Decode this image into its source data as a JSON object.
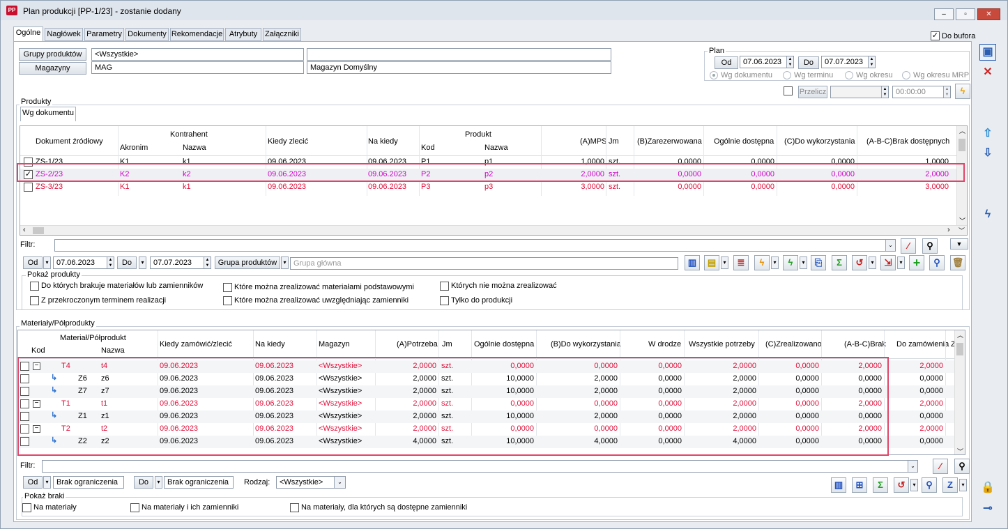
{
  "window": {
    "title": "Plan produkcji [PP-1/23] - zostanie dodany",
    "icon": "PP",
    "minimize": "‒",
    "maximize": "▫",
    "close": "✕"
  },
  "tabs": [
    "Ogólne",
    "Nagłówek",
    "Parametry",
    "Dokumenty",
    "Rekomendacje",
    "Atrybuty",
    "Załączniki"
  ],
  "do_bufora": "Do bufora",
  "header": {
    "grupy_btn": "Grupy produktów",
    "grupy_val": "<Wszystkie>",
    "magazyny_btn": "Magazyny",
    "magazyny_val": "MAG",
    "magazyny_name": "Magazyn Domyślny"
  },
  "plan": {
    "title": "Plan",
    "od": "Od",
    "od_date": "07.06.2023",
    "do": "Do",
    "do_date": "07.07.2023",
    "radios": [
      "Wg dokumentu",
      "Wg terminu",
      "Wg okresu",
      "Wg okresu MRP"
    ],
    "przelicz": "Przelicz",
    "time": "00:00:00"
  },
  "produkty": {
    "title": "Produkty",
    "subtab": "Wg dokumentu",
    "headers": {
      "dokument": "Dokument źródłowy",
      "kontrahent": "Kontrahent",
      "akronim": "Akronim",
      "nazwa": "Nazwa",
      "kiedy": "Kiedy zlecić",
      "na_kiedy": "Na kiedy",
      "produkt": "Produkt",
      "kod": "Kod",
      "pnazwa": "Nazwa",
      "mps": "(A)MPS",
      "jm": "Jm",
      "zarez": "(B)Zarezerwowana",
      "ogolnie": "Ogólnie dostępna",
      "dowyk": "(C)Do wykorzystania",
      "brak": "(A-B-C)Brak dostępnych"
    },
    "rows": [
      {
        "checked": false,
        "dok": "ZS-1/23",
        "akr": "K1",
        "nazwa": "k1",
        "kiedy": "09.06.2023",
        "na": "09.06.2023",
        "kod": "P1",
        "pn": "p1",
        "mps": "1,0000",
        "jm": "szt.",
        "zarez": "0,0000",
        "og": "0,0000",
        "dow": "0,0000",
        "brak": "1,0000",
        "red": false
      },
      {
        "checked": true,
        "dok": "ZS-2/23",
        "akr": "K2",
        "nazwa": "k2",
        "kiedy": "09.06.2023",
        "na": "09.06.2023",
        "kod": "P2",
        "pn": "p2",
        "mps": "2,0000",
        "jm": "szt.",
        "zarez": "0,0000",
        "og": "0,0000",
        "dow": "0,0000",
        "brak": "2,0000",
        "red": true
      },
      {
        "checked": false,
        "dok": "ZS-3/23",
        "akr": "K1",
        "nazwa": "k1",
        "kiedy": "09.06.2023",
        "na": "09.06.2023",
        "kod": "P3",
        "pn": "p3",
        "mps": "3,0000",
        "jm": "szt.",
        "zarez": "0,0000",
        "og": "0,0000",
        "dow": "0,0000",
        "brak": "3,0000",
        "red": true
      }
    ],
    "filtr": "Filtr:",
    "od": "Od",
    "od_date": "07.06.2023",
    "do": "Do",
    "do_date": "07.07.2023",
    "grupa_btn": "Grupa produktów",
    "grupa_val": "Grupa główna",
    "pokaz": "Pokaż produkty",
    "options": [
      "Do których brakuje materiałów lub zamienników",
      "Z przekroczonym terminem realizacji",
      "Które można zrealizować materiałami podstawowymi",
      "Które można zrealizować uwzględniając zamienniki",
      "Których nie można zrealizować",
      "Tylko do produkcji"
    ]
  },
  "materialy": {
    "title": "Materiały/Półprodukty",
    "headers": {
      "mp": "Materiał/Półprodukt",
      "kod": "Kod",
      "nazwa": "Nazwa",
      "kiedy": "Kiedy zamówić/zlecić",
      "na": "Na kiedy",
      "mag": "Magazyn",
      "potrz": "(A)Potrzeba",
      "jm": "Jm",
      "og": "Ogólnie dostępna",
      "dow": "(B)Do wykorzystania",
      "wd": "W drodze",
      "wsz": "Wszystkie potrzeby",
      "zreal": "(C)Zrealizowano",
      "brak": "(A-B-C)Brak",
      "dozam": "Do zamówienia",
      "z": "Z"
    },
    "rows": [
      {
        "lvl": 0,
        "kod": "T4",
        "nazwa": "t4",
        "kiedy": "09.06.2023",
        "na": "09.06.2023",
        "mag": "<Wszystkie>",
        "p": "2,0000",
        "jm": "szt.",
        "og": "0,0000",
        "dow": "0,0000",
        "wd": "0,0000",
        "wsz": "2,0000",
        "zr": "0,0000",
        "brak": "2,0000",
        "dz": "2,0000",
        "red": true
      },
      {
        "lvl": 1,
        "kod": "Z6",
        "nazwa": "z6",
        "kiedy": "09.06.2023",
        "na": "09.06.2023",
        "mag": "<Wszystkie>",
        "p": "2,0000",
        "jm": "szt.",
        "og": "10,0000",
        "dow": "2,0000",
        "wd": "0,0000",
        "wsz": "2,0000",
        "zr": "0,0000",
        "brak": "0,0000",
        "dz": "0,0000",
        "red": false
      },
      {
        "lvl": 1,
        "kod": "Z7",
        "nazwa": "z7",
        "kiedy": "09.06.2023",
        "na": "09.06.2023",
        "mag": "<Wszystkie>",
        "p": "2,0000",
        "jm": "szt.",
        "og": "10,0000",
        "dow": "2,0000",
        "wd": "0,0000",
        "wsz": "2,0000",
        "zr": "0,0000",
        "brak": "0,0000",
        "dz": "0,0000",
        "red": false
      },
      {
        "lvl": 0,
        "kod": "T1",
        "nazwa": "t1",
        "kiedy": "09.06.2023",
        "na": "09.06.2023",
        "mag": "<Wszystkie>",
        "p": "2,0000",
        "jm": "szt.",
        "og": "0,0000",
        "dow": "0,0000",
        "wd": "0,0000",
        "wsz": "2,0000",
        "zr": "0,0000",
        "brak": "2,0000",
        "dz": "2,0000",
        "red": true
      },
      {
        "lvl": 1,
        "kod": "Z1",
        "nazwa": "z1",
        "kiedy": "09.06.2023",
        "na": "09.06.2023",
        "mag": "<Wszystkie>",
        "p": "2,0000",
        "jm": "szt.",
        "og": "10,0000",
        "dow": "2,0000",
        "wd": "0,0000",
        "wsz": "2,0000",
        "zr": "0,0000",
        "brak": "0,0000",
        "dz": "0,0000",
        "red": false
      },
      {
        "lvl": 0,
        "kod": "T2",
        "nazwa": "t2",
        "kiedy": "09.06.2023",
        "na": "09.06.2023",
        "mag": "<Wszystkie>",
        "p": "2,0000",
        "jm": "szt.",
        "og": "0,0000",
        "dow": "0,0000",
        "wd": "0,0000",
        "wsz": "2,0000",
        "zr": "0,0000",
        "brak": "2,0000",
        "dz": "2,0000",
        "red": true
      },
      {
        "lvl": 1,
        "kod": "Z2",
        "nazwa": "z2",
        "kiedy": "09.06.2023",
        "na": "09.06.2023",
        "mag": "<Wszystkie>",
        "p": "4,0000",
        "jm": "szt.",
        "og": "10,0000",
        "dow": "4,0000",
        "wd": "0,0000",
        "wsz": "4,0000",
        "zr": "0,0000",
        "brak": "0,0000",
        "dz": "0,0000",
        "red": false
      }
    ],
    "filtr": "Filtr:",
    "od": "Od",
    "od_val": "Brak ograniczenia",
    "do": "Do",
    "do_val": "Brak ograniczenia",
    "rodzaj": "Rodzaj:",
    "rodzaj_val": "<Wszystkie>",
    "pokaz": "Pokaż braki",
    "options": [
      "Na materiały",
      "Na materiały i ich zamienniki",
      "Na materiały, dla których są dostępne zamienniki"
    ]
  },
  "colors": {
    "red": "#e0103a",
    "magenta": "#d000c8",
    "highlight": "#e0446a"
  }
}
